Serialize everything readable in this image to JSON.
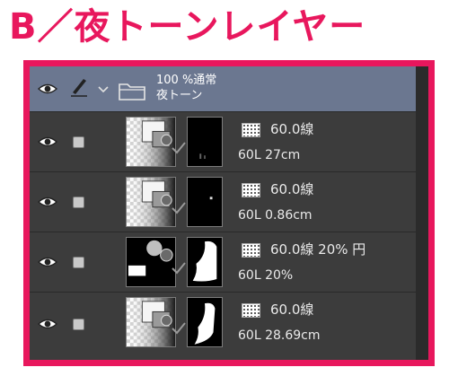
{
  "heading": "B／夜トーンレイヤー",
  "folder": {
    "opacity_blend": "100 %通常",
    "name": "夜トーン"
  },
  "layers": [
    {
      "tone": "60.0線",
      "name": "60L 27cm"
    },
    {
      "tone": "60.0線",
      "name": "60L 0.86cm"
    },
    {
      "tone": "60.0線 20% 円",
      "name": "60L 20%"
    },
    {
      "tone": "60.0線",
      "name": "60L 28.69cm"
    }
  ],
  "icons": {
    "eye": "eye-icon",
    "pen": "pen-icon",
    "lock": "checkbox-icon",
    "folder": "folder-icon",
    "caret": "chevron-down-icon",
    "tone": "tone-pattern-icon",
    "mask_link": "checkmark-icon"
  },
  "colors": {
    "accent": "#e8175d",
    "folder_row": "#6b7790",
    "panel_bg": "#3c3c3c",
    "side_cols": "#bdbdbd"
  }
}
